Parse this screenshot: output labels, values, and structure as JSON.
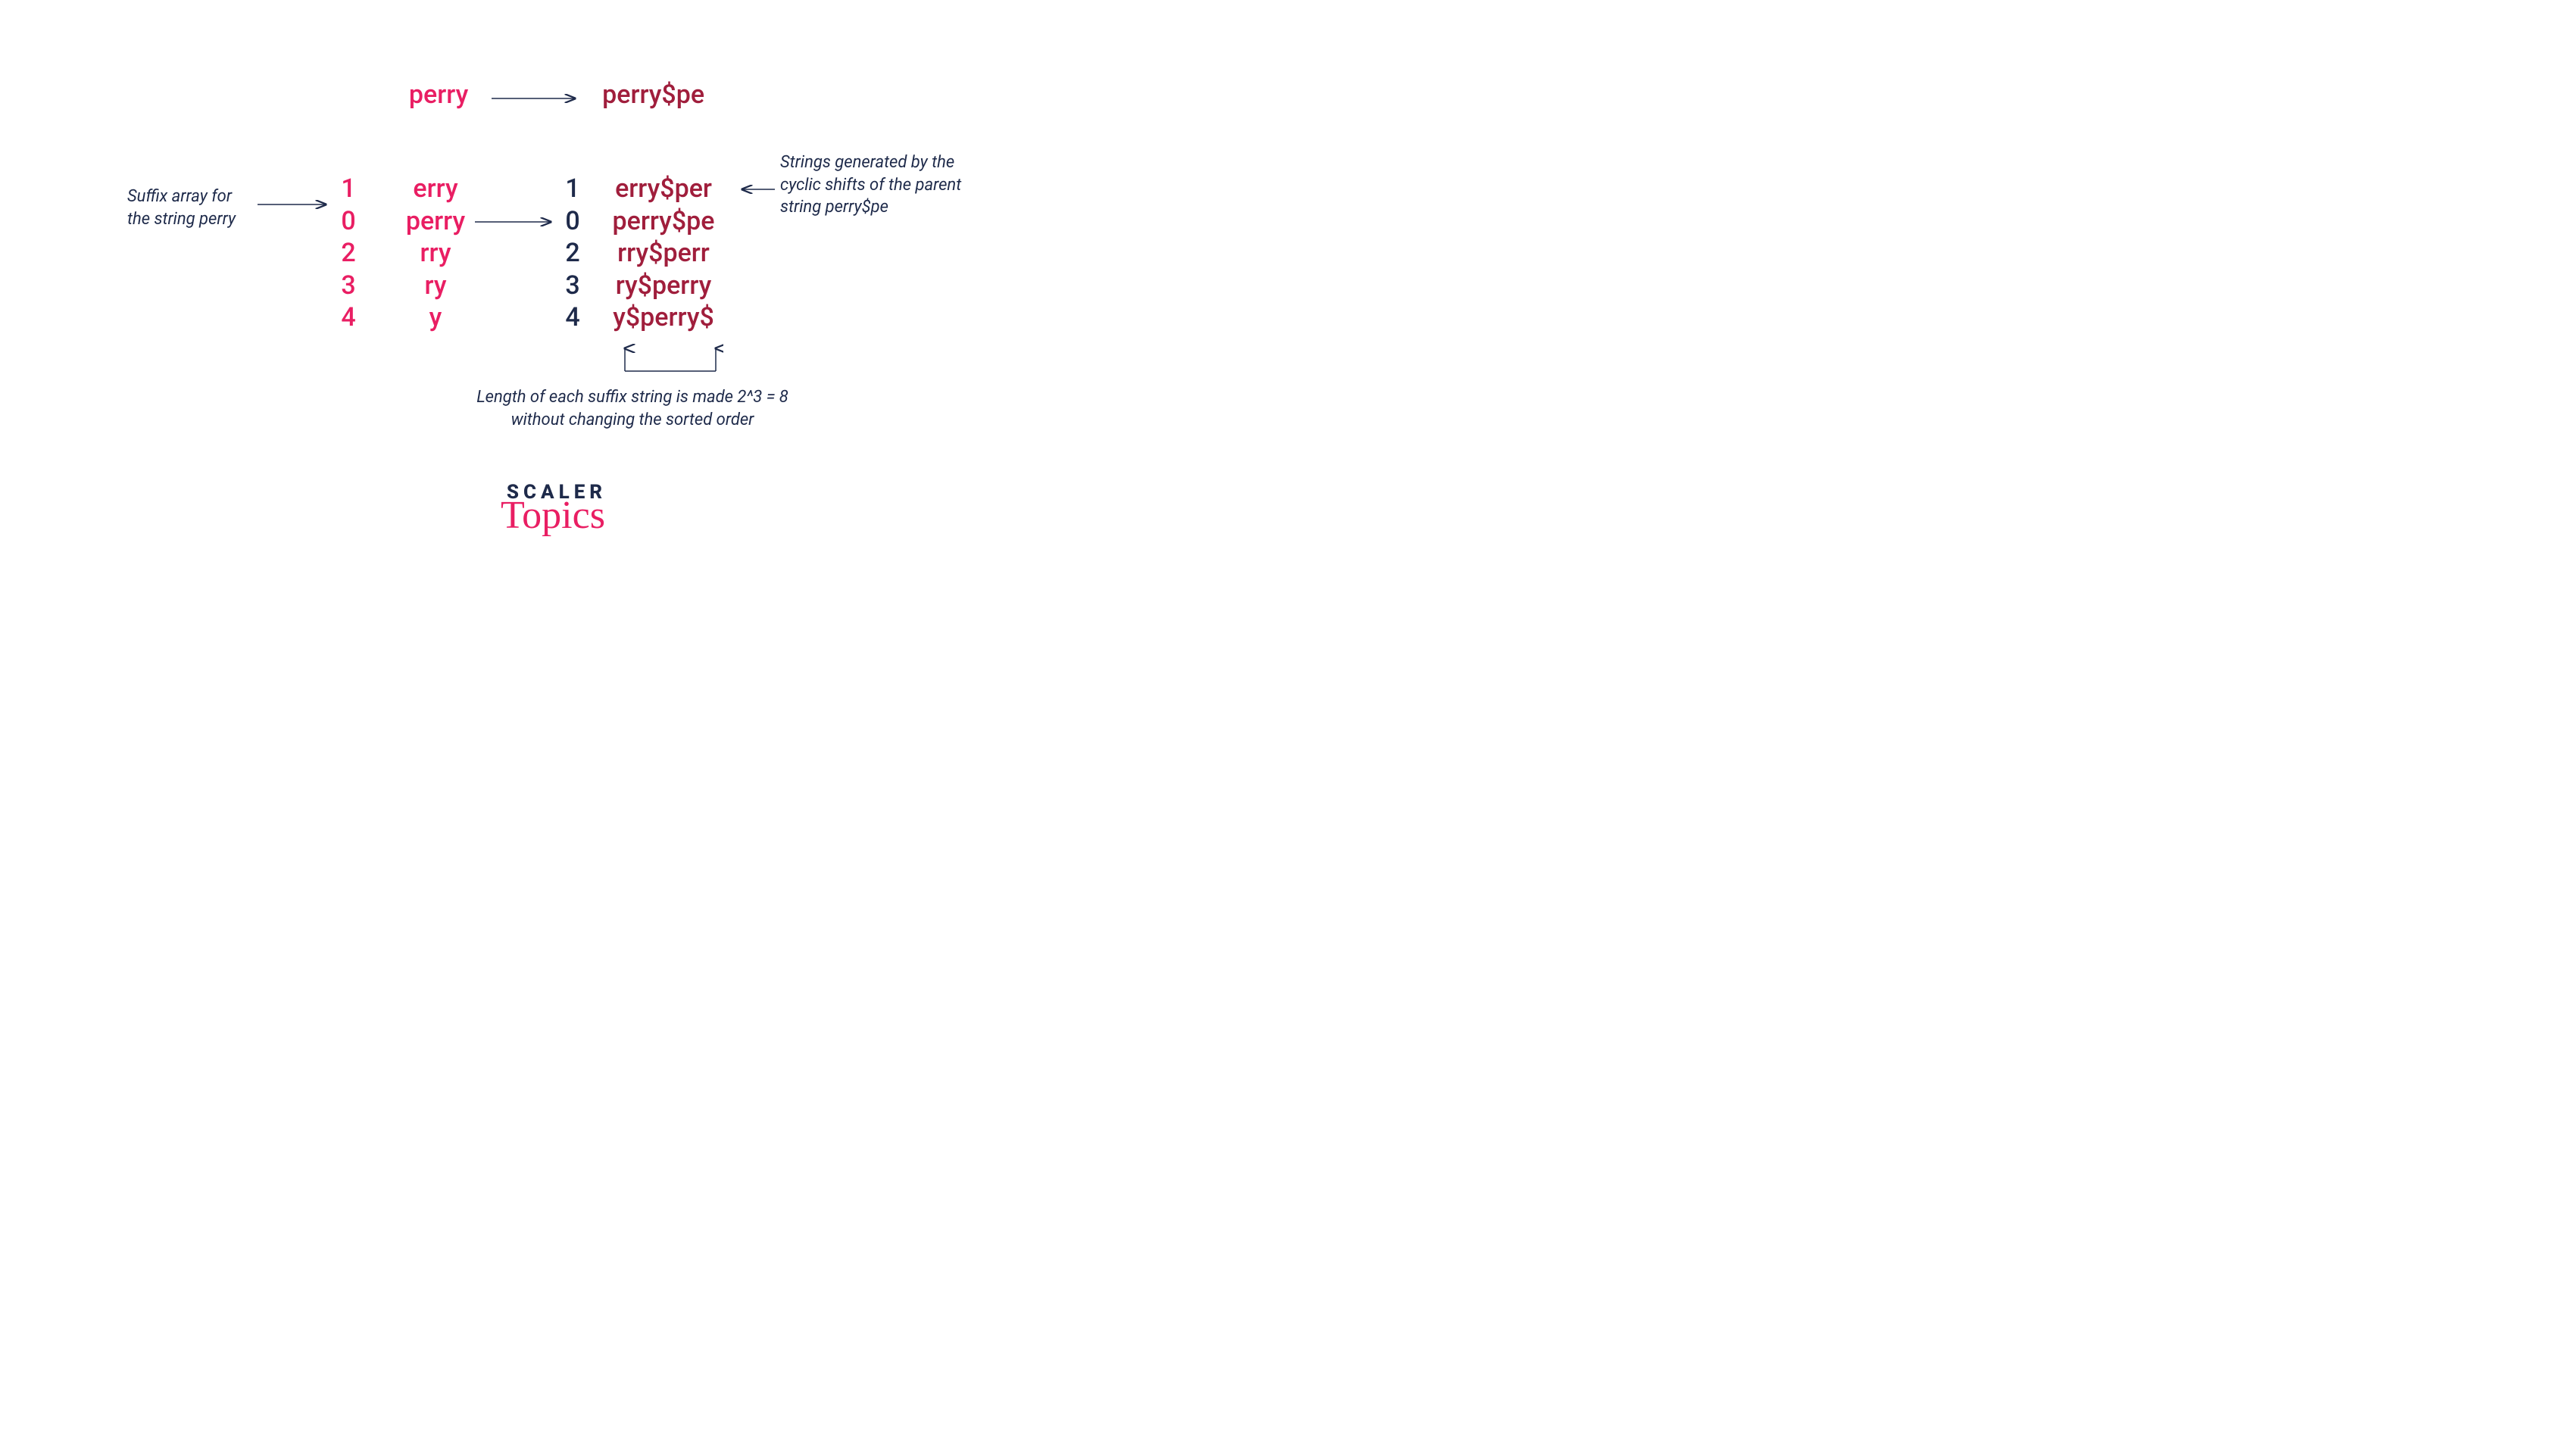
{
  "header": {
    "left": "perry",
    "right": "perry$pe"
  },
  "left_note": {
    "line1": "Suffix array for",
    "line2": "the string perry"
  },
  "suffix_left": {
    "rows": [
      {
        "idx": "1",
        "str": "erry"
      },
      {
        "idx": "0",
        "str": "perry"
      },
      {
        "idx": "2",
        "str": "rry"
      },
      {
        "idx": "3",
        "str": "ry"
      },
      {
        "idx": "4",
        "str": "y"
      }
    ]
  },
  "suffix_right": {
    "rows": [
      {
        "idx": "1",
        "str": "erry$per"
      },
      {
        "idx": "0",
        "str": "perry$pe"
      },
      {
        "idx": "2",
        "str": "rry$perr"
      },
      {
        "idx": "3",
        "str": "ry$perry"
      },
      {
        "idx": "4",
        "str": "y$perry$"
      }
    ]
  },
  "right_note": {
    "line1": "Strings generated by the",
    "line2": "cyclic shifts of the parent",
    "line3": "string perry$pe"
  },
  "bottom_note": {
    "line1": "Length of each suffix string is made 2^3 = 8",
    "line2": "without changing the sorted order"
  },
  "logo": {
    "brand": "SCALER",
    "sub": "Topics"
  }
}
